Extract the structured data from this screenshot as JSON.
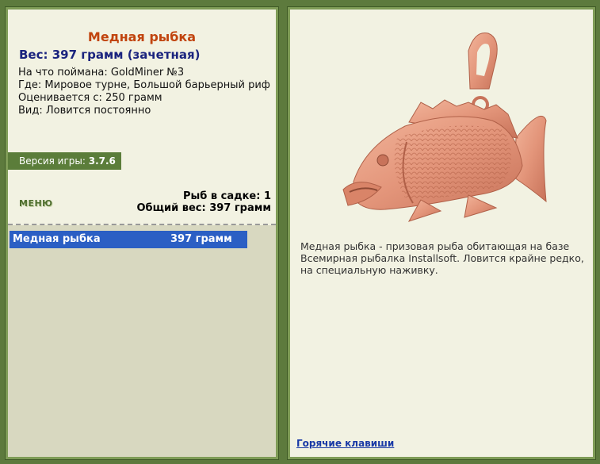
{
  "fish": {
    "title": "Медная рыбка",
    "weight_line": "Вес: 397 грамм (зачетная)",
    "bait": "На что поймана: GoldMiner №3",
    "place": "Где: Мировое турне, Большой барьерный риф",
    "value": "Оцениваeтся с: 250 грамм",
    "kind": "Вид: Ловится постоянно"
  },
  "version": {
    "label": "Версия игры: ",
    "value": "3.7.6"
  },
  "menu_label": "МЕНЮ",
  "stats": {
    "count": "Рыб в садке: 1",
    "total": "Общий вес: 397 грамм"
  },
  "catch_list": [
    {
      "name": "Медная рыбка",
      "weight": "397 грамм"
    }
  ],
  "description": "Медная рыбка - призовая рыба обитающая на базе Всемирная рыбалка Installsoft. Ловится крайне редко, на специальную наживку.",
  "hotkeys_label": "Горячие клавиши",
  "colors": {
    "frame": "#5d7a3d",
    "panel": "#f2f2e2",
    "title": "#c1440e",
    "weight": "#1a237e",
    "selection": "#2b5fc4",
    "copper": "#e3957a"
  }
}
